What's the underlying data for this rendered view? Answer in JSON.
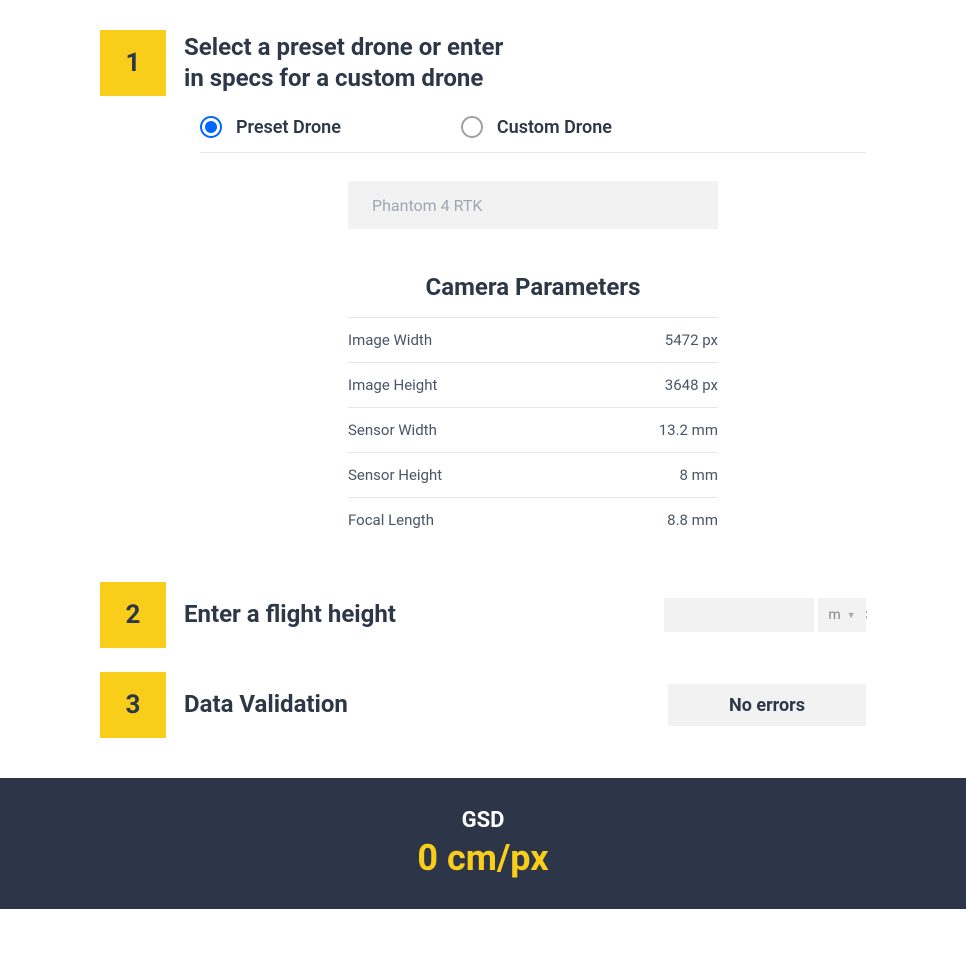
{
  "steps": {
    "1": {
      "number": "1",
      "title_line1": "Select a preset drone or enter",
      "title_line2": "in specs for a custom drone"
    },
    "2": {
      "number": "2",
      "title": "Enter a flight height"
    },
    "3": {
      "number": "3",
      "title": "Data Validation"
    }
  },
  "drone_type": {
    "options": [
      {
        "label": "Preset Drone",
        "selected": true
      },
      {
        "label": "Custom Drone",
        "selected": false
      }
    ]
  },
  "preset_selected": "Phantom 4 RTK",
  "camera_params": {
    "heading": "Camera Parameters",
    "rows": [
      {
        "label": "Image Width",
        "value": "5472 px"
      },
      {
        "label": "Image Height",
        "value": "3648 px"
      },
      {
        "label": "Sensor Width",
        "value": "13.2 mm"
      },
      {
        "label": "Sensor Height",
        "value": "8 mm"
      },
      {
        "label": "Focal Length",
        "value": "8.8 mm"
      }
    ]
  },
  "flight_height": {
    "value": "",
    "unit": "m"
  },
  "validation": {
    "status": "No errors"
  },
  "result": {
    "label": "GSD",
    "value": "0",
    "unit": "cm/px"
  }
}
